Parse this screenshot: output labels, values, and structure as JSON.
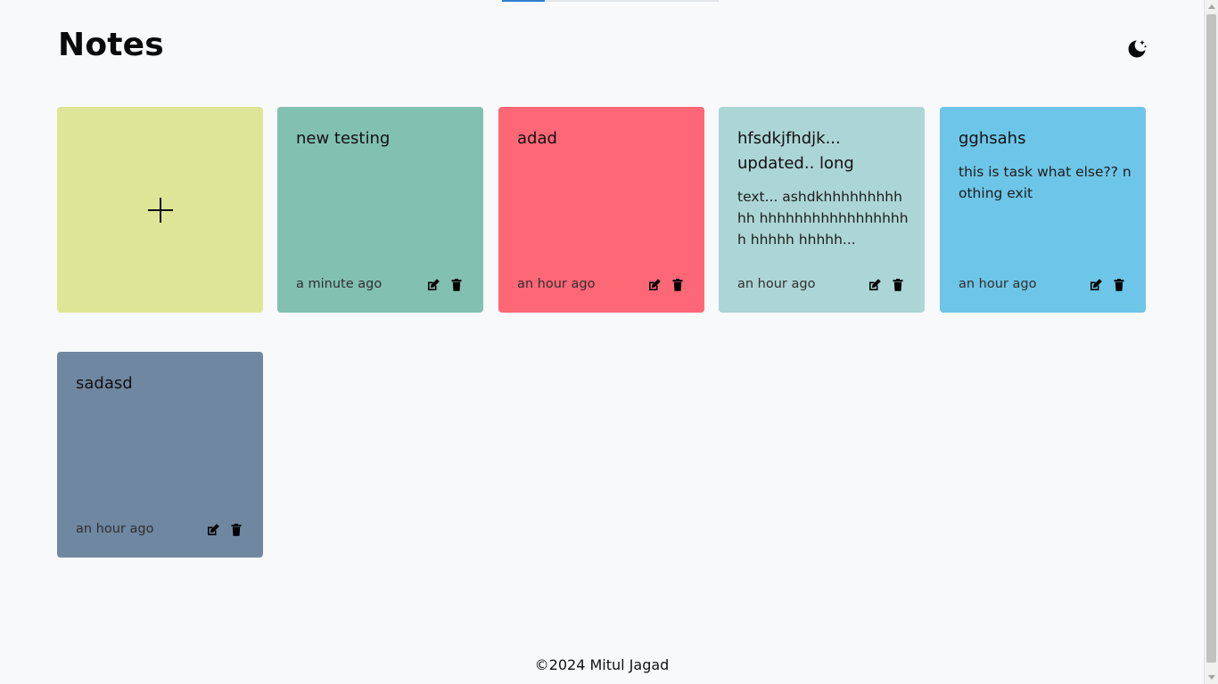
{
  "app": {
    "title": "Notes",
    "theme_icon": "moon-stars-icon"
  },
  "add_card": {
    "icon": "plus-icon",
    "color": "#dfe597"
  },
  "notes": [
    {
      "title": "new testing",
      "body": "",
      "time": "a minute ago",
      "color": "#82c0b1"
    },
    {
      "title": "adad",
      "body": "",
      "time": "an hour ago",
      "color": "#fe6776"
    },
    {
      "title": "hfsdkjfhdjk... updated.. long",
      "body": "text... ashdkhhhhhhhhhhh hhhhhhhhhhhhhhhhhh hhhhh hhhhh...",
      "time": "an hour ago",
      "color": "#acd5d6"
    },
    {
      "title": "gghsahs",
      "body": "this is task what else?? nothing exit",
      "time": "an hour ago",
      "color": "#6dc5e7"
    },
    {
      "title": "sadasd",
      "body": "",
      "time": "an hour ago",
      "color": "#6f87a0"
    }
  ],
  "icons": {
    "edit": "edit-icon",
    "delete": "trash-icon"
  },
  "footer": {
    "text": "©2024 Mitul Jagad"
  }
}
